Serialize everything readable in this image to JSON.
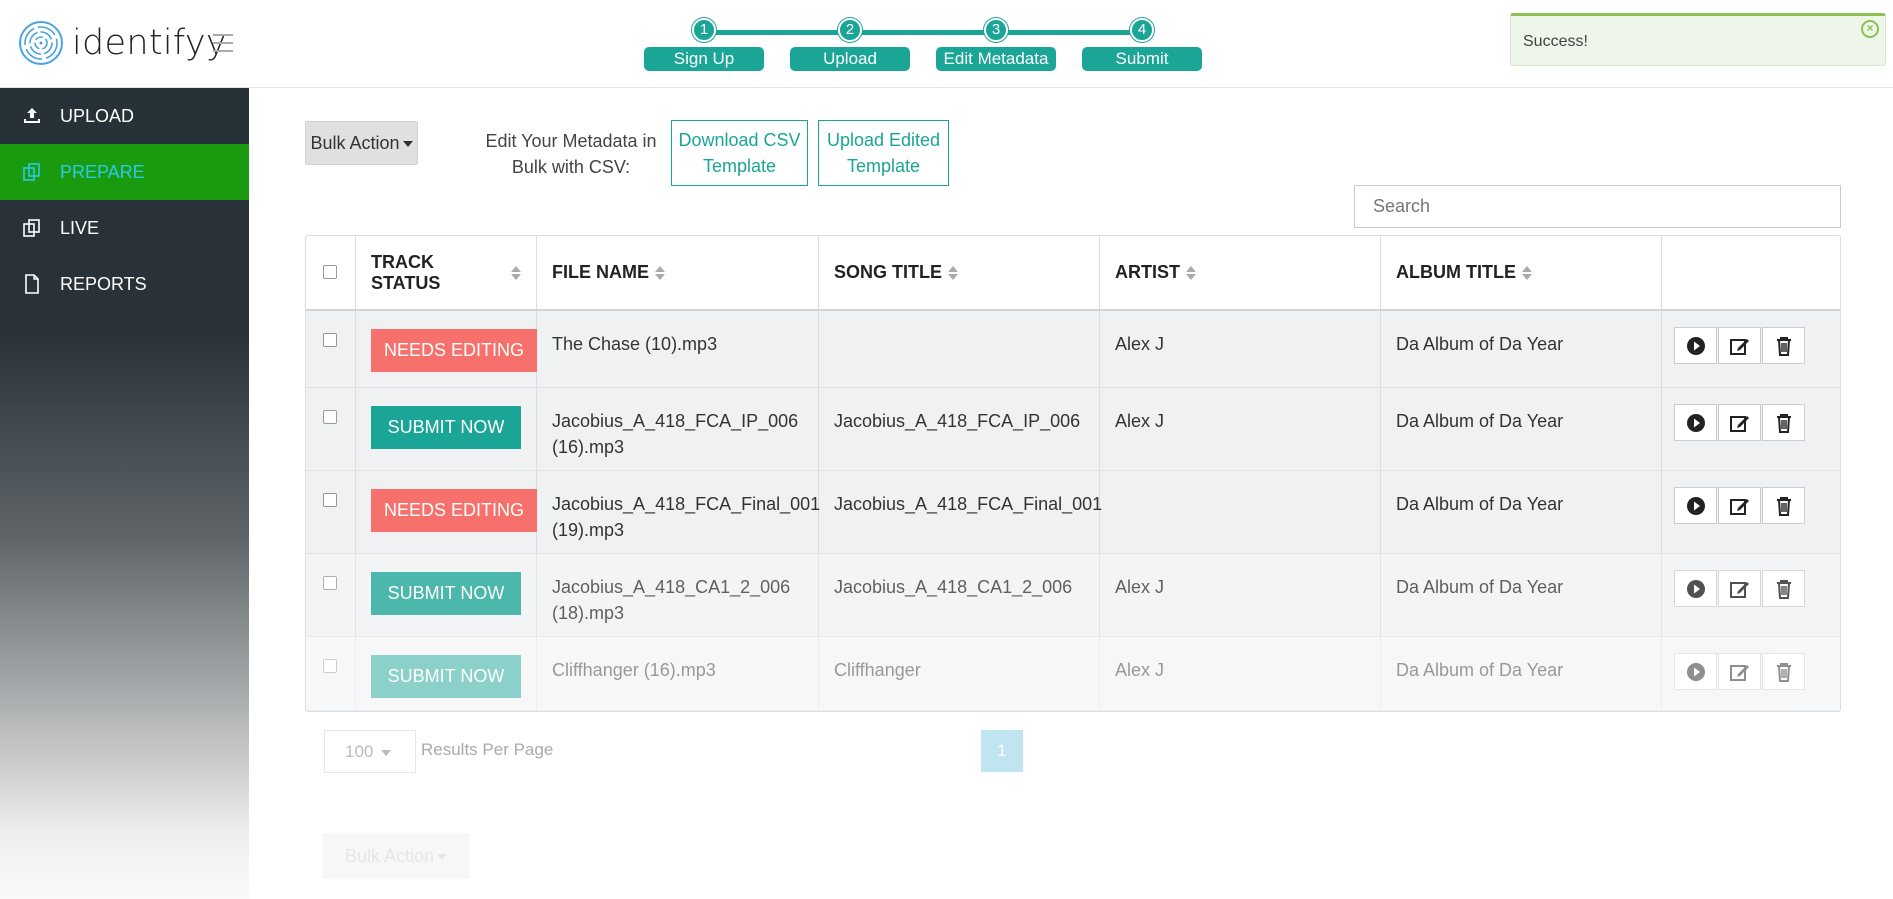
{
  "app": {
    "brand": "identifyy"
  },
  "steps": [
    {
      "num": "1",
      "label": "Sign Up"
    },
    {
      "num": "2",
      "label": "Upload"
    },
    {
      "num": "3",
      "label": "Edit Metadata"
    },
    {
      "num": "4",
      "label": "Submit"
    }
  ],
  "toast": {
    "message": "Success!"
  },
  "sidebar": {
    "items": [
      {
        "label": "UPLOAD",
        "icon": "upload-icon",
        "active": false
      },
      {
        "label": "PREPARE",
        "icon": "copy-icon",
        "active": true
      },
      {
        "label": "LIVE",
        "icon": "copy-icon",
        "active": false
      },
      {
        "label": "REPORTS",
        "icon": "document-icon",
        "active": false
      }
    ]
  },
  "toolbar": {
    "bulk_action": "Bulk Action",
    "csv_label": "Edit Your Metadata in Bulk with CSV:",
    "download_btn": "Download CSV Template",
    "upload_btn": "Upload Edited Template"
  },
  "search": {
    "placeholder": "Search"
  },
  "table": {
    "columns": [
      "TRACK STATUS",
      "FILE NAME",
      "SONG TITLE",
      "ARTIST",
      "ALBUM TITLE"
    ],
    "rows": [
      {
        "status": "NEEDS EDITING",
        "file": "The Chase (10).mp3",
        "song": "",
        "artist": "Alex J",
        "album": "Da Album of Da Year"
      },
      {
        "status": "SUBMIT NOW",
        "file": "Jacobius_A_418_FCA_IP_006 (16).mp3",
        "song": "Jacobius_A_418_FCA_IP_006",
        "artist": "Alex J",
        "album": "Da Album of Da Year"
      },
      {
        "status": "NEEDS EDITING",
        "file": "Jacobius_A_418_FCA_Final_001 (19).mp3",
        "song": "Jacobius_A_418_FCA_Final_001",
        "artist": "",
        "album": "Da Album of Da Year"
      },
      {
        "status": "SUBMIT NOW",
        "file": "Jacobius_A_418_CA1_2_006 (18).mp3",
        "song": "Jacobius_A_418_CA1_2_006",
        "artist": "Alex J",
        "album": "Da Album of Da Year"
      },
      {
        "status": "SUBMIT NOW",
        "file": "Cliffhanger (16).mp3",
        "song": "Cliffhanger",
        "artist": "Alex J",
        "album": "Da Album of Da Year"
      }
    ]
  },
  "pagination": {
    "per_page": "100",
    "per_page_label": "Results Per Page",
    "current_page": "1"
  },
  "colors": {
    "accent": "#1aa596",
    "needs_editing": "#f7716c",
    "active_nav_bg": "#1a9a0f",
    "active_nav_text": "#2ec8e8",
    "toast_border": "#8cc152"
  }
}
